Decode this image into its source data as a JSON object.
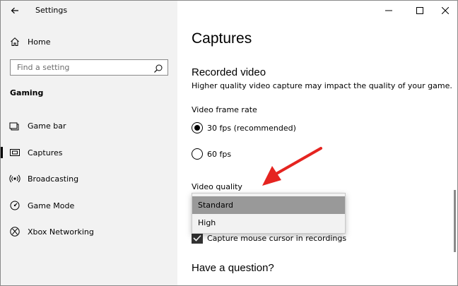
{
  "window": {
    "title": "Settings",
    "controls": [
      "minimize",
      "maximize",
      "close"
    ]
  },
  "sidebar": {
    "home_label": "Home",
    "search_placeholder": "Find a setting",
    "section_heading": "Gaming",
    "items": [
      {
        "label": "Game bar",
        "icon": "game-bar-icon",
        "selected": false
      },
      {
        "label": "Captures",
        "icon": "captures-icon",
        "selected": true
      },
      {
        "label": "Broadcasting",
        "icon": "broadcasting-icon",
        "selected": false
      },
      {
        "label": "Game Mode",
        "icon": "game-mode-icon",
        "selected": false
      },
      {
        "label": "Xbox Networking",
        "icon": "xbox-icon",
        "selected": false
      }
    ]
  },
  "main": {
    "page_title": "Captures",
    "recorded_video": {
      "heading": "Recorded video",
      "description": "Higher quality video capture may impact the quality of your game.",
      "frame_rate_label": "Video frame rate",
      "frame_rate_options": [
        {
          "label": "30 fps (recommended)",
          "checked": true
        },
        {
          "label": "60 fps",
          "checked": false
        }
      ],
      "quality_label": "Video quality",
      "quality_options": [
        {
          "label": "Standard",
          "highlighted": true
        },
        {
          "label": "High",
          "highlighted": false
        }
      ],
      "capture_cursor_label": "Capture mouse cursor in recordings",
      "capture_cursor_checked": true
    },
    "question_heading": "Have a question?"
  },
  "annotation": {
    "arrow_color": "#e52420"
  },
  "colors": {
    "sidebar_bg": "#f2f2f2",
    "dropdown_bg": "#f2f2f2",
    "dropdown_selected_bg": "#999999"
  }
}
